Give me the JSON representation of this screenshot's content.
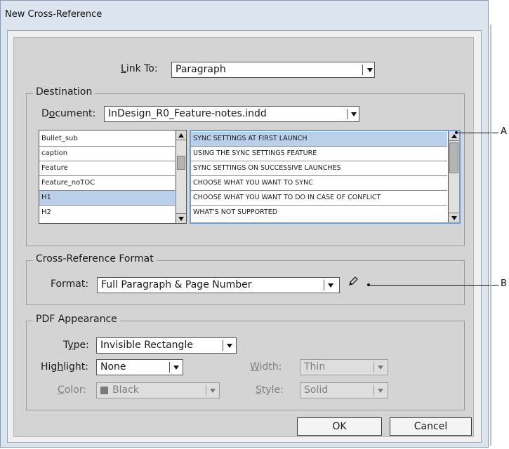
{
  "dialog": {
    "title": "New Cross-Reference"
  },
  "link_to": {
    "label": "Link To:",
    "value": "Paragraph"
  },
  "destination": {
    "legend": "Destination",
    "document_label": "Document:",
    "document_value": "InDesign_R0_Feature-notes.indd",
    "styles": [
      "Bullet_sub",
      "caption",
      "Feature",
      "Feature_noTOC",
      "H1",
      "H2"
    ],
    "selected_style": "H1",
    "paragraphs": [
      "SYNC SETTINGS AT FIRST LAUNCH",
      "USING THE SYNC SETTINGS FEATURE",
      "SYNC SETTINGS ON SUCCESSIVE LAUNCHES",
      "CHOOSE WHAT YOU WANT TO SYNC",
      "CHOOSE WHAT YOU WANT TO DO IN CASE OF CONFLICT",
      "WHAT'S NOT SUPPORTED"
    ],
    "selected_paragraph": "SYNC SETTINGS AT FIRST LAUNCH"
  },
  "format_section": {
    "legend": "Cross-Reference Format",
    "format_label": "Format:",
    "format_value": "Full Paragraph & Page Number",
    "edit_icon": "pencil-icon"
  },
  "pdf": {
    "legend": "PDF Appearance",
    "type_label": "Type:",
    "type_value": "Invisible Rectangle",
    "highlight_label": "Highlight:",
    "highlight_value": "None",
    "width_label": "Width:",
    "width_value": "Thin",
    "color_label": "Color:",
    "color_value": "Black",
    "color_swatch": "#7a7a7a",
    "style_label": "Style:",
    "style_value": "Solid"
  },
  "buttons": {
    "ok": "OK",
    "cancel": "Cancel"
  },
  "callouts": {
    "a": "A",
    "b": "B"
  }
}
